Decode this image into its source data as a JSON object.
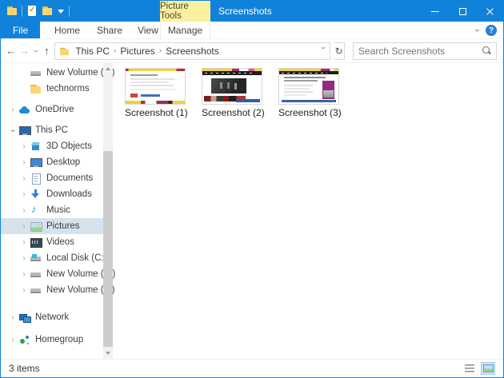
{
  "colors": {
    "titlebar": "#1182d9",
    "contextual_tab_bg": "#f9f1a0",
    "selection_bg": "#d6e2ee",
    "accent": "#1182d9"
  },
  "titlebar": {
    "contextual_tab": "Picture Tools",
    "title": "Screenshots",
    "qat_icons": [
      "explorer-icon",
      "properties-icon",
      "new-folder-icon",
      "customize-quick-access-dropdown-icon"
    ]
  },
  "ribbon": {
    "file_tab": "File",
    "tabs": [
      "Home",
      "Share",
      "View"
    ],
    "contextual_tab": "Manage"
  },
  "toolbar": {
    "breadcrumb": [
      "This PC",
      "Pictures",
      "Screenshots"
    ],
    "search_placeholder": "Search Screenshots"
  },
  "glyphs": {
    "back": "←",
    "forward": "→",
    "up": "↑",
    "chevron": "›",
    "refresh": "↻",
    "help": "?"
  },
  "sidebar": {
    "items": [
      {
        "label": "New Volume (F:)",
        "icon": "drive-icon"
      },
      {
        "label": "technorms",
        "icon": "folder-icon"
      },
      {
        "label": "OneDrive",
        "icon": "onedrive-cloud-icon"
      },
      {
        "label": "This PC",
        "icon": "this-pc-icon"
      },
      {
        "label": "3D Objects",
        "icon": "3d-objects-icon"
      },
      {
        "label": "Desktop",
        "icon": "desktop-icon"
      },
      {
        "label": "Documents",
        "icon": "documents-icon"
      },
      {
        "label": "Downloads",
        "icon": "downloads-icon"
      },
      {
        "label": "Music",
        "icon": "music-icon"
      },
      {
        "label": "Pictures",
        "icon": "pictures-icon",
        "selected": true
      },
      {
        "label": "Videos",
        "icon": "videos-icon"
      },
      {
        "label": "Local Disk (C:)",
        "icon": "system-drive-icon"
      },
      {
        "label": "New Volume (E:)",
        "icon": "drive-icon"
      },
      {
        "label": "New Volume (F:)",
        "icon": "drive-icon"
      },
      {
        "label": "Network",
        "icon": "network-icon"
      },
      {
        "label": "Homegroup",
        "icon": "homegroup-icon"
      }
    ]
  },
  "files": [
    {
      "name": "Screenshot (1)"
    },
    {
      "name": "Screenshot (2)"
    },
    {
      "name": "Screenshot (3)"
    }
  ],
  "statusbar": {
    "count": "3 items"
  }
}
